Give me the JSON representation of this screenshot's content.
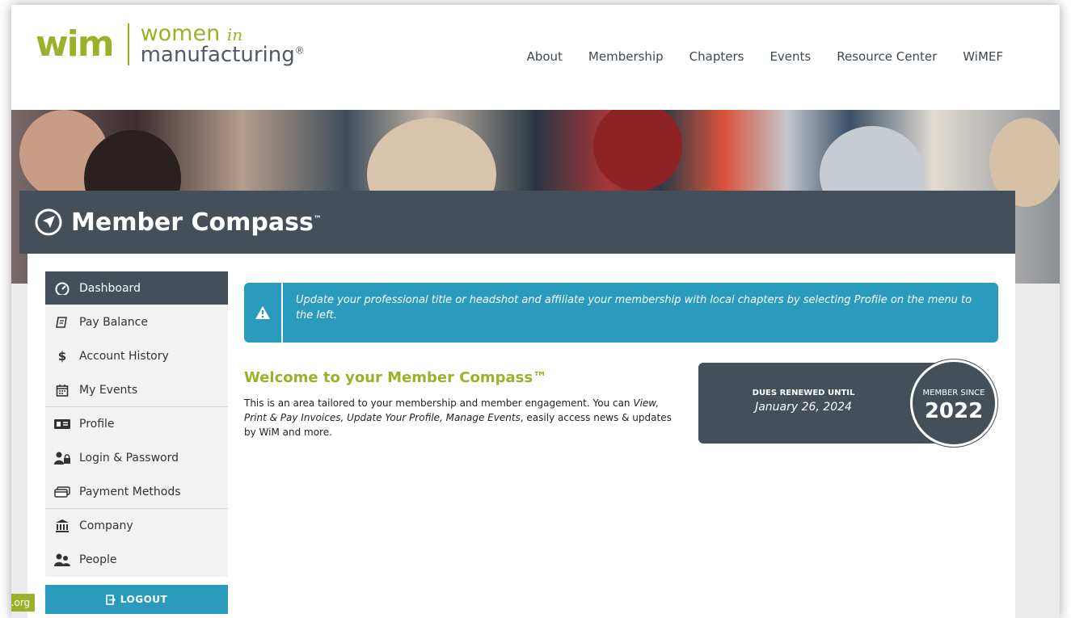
{
  "logo": {
    "brand": "wim",
    "line1": "women",
    "line1_accent": "in",
    "line2": "manufacturing",
    "mark": "®"
  },
  "nav": [
    "About",
    "Membership",
    "Chapters",
    "Events",
    "Resource Center",
    "WiMEF"
  ],
  "hero": {
    "title": "Member Compass",
    "trademark": "™"
  },
  "sidebar": {
    "items": [
      {
        "label": "Dashboard",
        "icon": "dashboard-icon"
      },
      {
        "label": "Pay Balance",
        "icon": "invoice-icon"
      },
      {
        "label": "Account History",
        "icon": "dollar-icon"
      },
      {
        "label": "My Events",
        "icon": "calendar-icon"
      },
      {
        "label": "Profile",
        "icon": "id-card-icon"
      },
      {
        "label": "Login & Password",
        "icon": "user-lock-icon"
      },
      {
        "label": "Payment Methods",
        "icon": "credit-card-icon"
      },
      {
        "label": "Company",
        "icon": "bank-icon"
      },
      {
        "label": "People",
        "icon": "users-icon"
      }
    ],
    "logout": "LOGOUT"
  },
  "alert": {
    "text": "Update your professional title or headshot and affiliate your membership with  local chapters by selecting Profile on the menu to the left."
  },
  "welcome": {
    "title": "Welcome to your Member Compass™",
    "body_part1": "This is an area tailored to your membership and member engagement. You can ",
    "body_em": "View, Print & Pay Invoices, Update Your Profile, Manage Events",
    "body_part2": ", easily access news & updates by WiM and more."
  },
  "dues": {
    "label": "DUES RENEWED UNTIL",
    "date": "January 26, 2024"
  },
  "member_since": {
    "label": "MEMBER SINCE",
    "year": "2022"
  },
  "status_url": "g.org",
  "colors": {
    "brand_green": "#9ab22a",
    "slate": "#454f5a",
    "accent_blue": "#2a9bbd"
  }
}
